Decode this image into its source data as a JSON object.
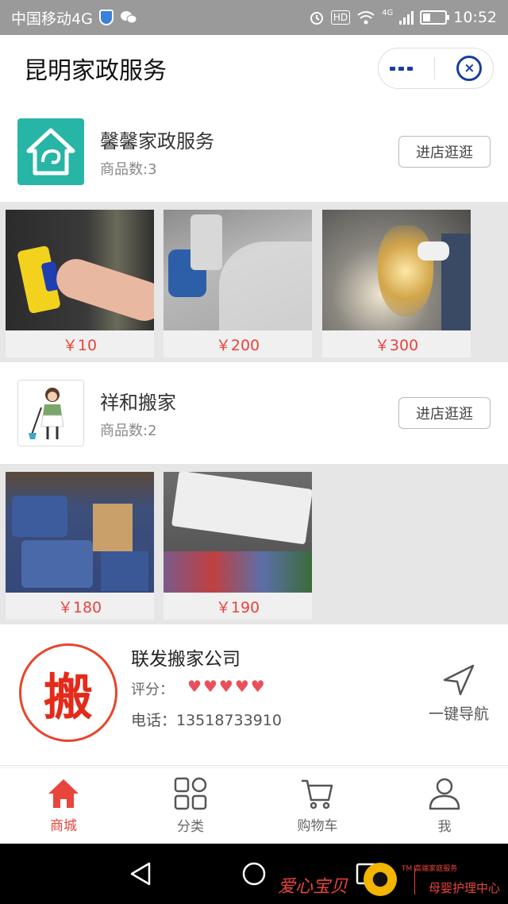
{
  "status_bar": {
    "carrier": "中国移动4G",
    "hd_badge": "HD",
    "network_badge": "4G",
    "time": "10:52"
  },
  "header": {
    "title": "昆明家政服务"
  },
  "stores": [
    {
      "name": "馨馨家政服务",
      "count": "商品数:3",
      "visit_label": "进店逛逛",
      "products": [
        {
          "price": "￥10",
          "image": "window-cleaning"
        },
        {
          "price": "￥200",
          "image": "floor-polishing"
        },
        {
          "price": "￥300",
          "image": "chandelier-cleaning"
        }
      ]
    },
    {
      "name": "祥和搬家",
      "count": "商品数:2",
      "visit_label": "进店逛逛",
      "products": [
        {
          "price": "￥180",
          "image": "truck-packed-boxes"
        },
        {
          "price": "￥190",
          "image": "refrigerator-moving"
        }
      ]
    }
  ],
  "company": {
    "logo_char": "搬",
    "name": "联发搬家公司",
    "rating_label": "评分：",
    "rating": 5,
    "phone": "电话：13518733910",
    "nav_label": "一键导航"
  },
  "tabbar": [
    {
      "label": "商城",
      "icon": "home-icon",
      "active": true
    },
    {
      "label": "分类",
      "icon": "grid-icon",
      "active": false
    },
    {
      "label": "购物车",
      "icon": "cart-icon",
      "active": false
    },
    {
      "label": "我",
      "icon": "user-icon",
      "active": false
    }
  ],
  "watermark": {
    "brand": "爱心宝贝",
    "sub": "母婴护理中心",
    "tiny": "TM 高端家庭服务"
  },
  "colors": {
    "accent": "#e8453c",
    "capsule_blue": "#1a3e9e",
    "store1_logo_bg": "#27b5a6"
  }
}
